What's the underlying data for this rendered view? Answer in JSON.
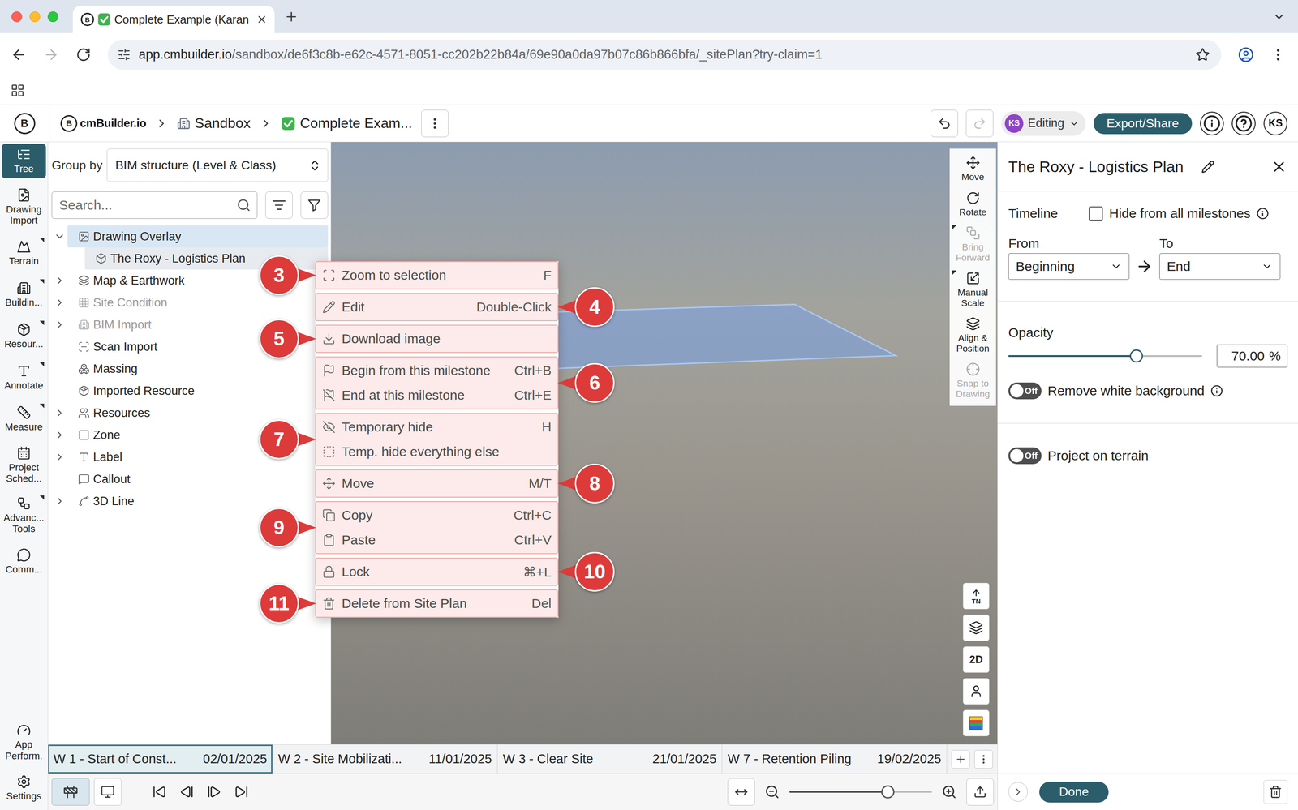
{
  "browser": {
    "tab": {
      "title": "Complete Example (Karan",
      "selected": true
    },
    "url_host": "app.cmbuilder.io",
    "url_path": "/sandbox/de6f3c8b-e62c-4571-8051-cc202b22b84a/69e90a0da97b07c86b866bfa/_sitePlan?try-claim=1",
    "forward_disabled": true
  },
  "header": {
    "logo_mark": "B",
    "brand": "cmBuilder.io",
    "breadcrumb": [
      "Sandbox",
      "Complete Exam..."
    ],
    "redo_disabled": true,
    "mode": {
      "avatar": "KS",
      "label": "Editing"
    },
    "export_label": "Export/Share",
    "user": "KS"
  },
  "rail": {
    "items": [
      {
        "label": "Tree",
        "selected": true,
        "has_submenu": false
      },
      {
        "label": "Drawing Import",
        "selected": false,
        "has_submenu": false
      },
      {
        "label": "Terrain",
        "selected": false,
        "has_submenu": true
      },
      {
        "label": "Buildin...",
        "selected": false,
        "has_submenu": true
      },
      {
        "label": "Resour...",
        "selected": false,
        "has_submenu": true
      },
      {
        "label": "Annotate",
        "selected": false,
        "has_submenu": true
      },
      {
        "label": "Measure",
        "selected": false,
        "has_submenu": true
      },
      {
        "label": "Project Sched...",
        "selected": false,
        "has_submenu": false
      },
      {
        "label": "Advanc... Tools",
        "selected": false,
        "has_submenu": true
      },
      {
        "label": "Comm...",
        "selected": false,
        "has_submenu": false
      }
    ],
    "bottom_items": [
      {
        "label": "App Perform.",
        "selected": false
      },
      {
        "label": "Settings",
        "selected": false
      }
    ]
  },
  "tree": {
    "group_by_label": "Group by",
    "group_by_value": "BIM structure (Level & Class)",
    "search_placeholder": "Search...",
    "items": [
      {
        "label": "Drawing Overlay",
        "level": 0,
        "expandable": true,
        "expanded": true,
        "selected": true,
        "context_target": false,
        "disabled": false
      },
      {
        "label": "The Roxy - Logistics Plan",
        "level": 1,
        "expandable": false,
        "expanded": false,
        "selected": false,
        "context_target": true,
        "disabled": false
      },
      {
        "label": "Map & Earthwork",
        "level": 0,
        "expandable": true,
        "expanded": false,
        "selected": false,
        "context_target": false,
        "disabled": false
      },
      {
        "label": "Site Condition",
        "level": 0,
        "expandable": true,
        "expanded": false,
        "selected": false,
        "context_target": false,
        "disabled": true
      },
      {
        "label": "BIM Import",
        "level": 0,
        "expandable": true,
        "expanded": false,
        "selected": false,
        "context_target": false,
        "disabled": true
      },
      {
        "label": "Scan Import",
        "level": 0,
        "expandable": false,
        "expanded": false,
        "selected": false,
        "context_target": false,
        "disabled": false
      },
      {
        "label": "Massing",
        "level": 0,
        "expandable": false,
        "expanded": false,
        "selected": false,
        "context_target": false,
        "disabled": false
      },
      {
        "label": "Imported Resource",
        "level": 0,
        "expandable": false,
        "expanded": false,
        "selected": false,
        "context_target": false,
        "disabled": false
      },
      {
        "label": "Resources",
        "level": 0,
        "expandable": true,
        "expanded": false,
        "selected": false,
        "context_target": false,
        "disabled": false
      },
      {
        "label": "Zone",
        "level": 0,
        "expandable": true,
        "expanded": false,
        "selected": false,
        "context_target": false,
        "disabled": false
      },
      {
        "label": "Label",
        "level": 0,
        "expandable": true,
        "expanded": false,
        "selected": false,
        "context_target": false,
        "disabled": false
      },
      {
        "label": "Callout",
        "level": 0,
        "expandable": false,
        "expanded": false,
        "selected": false,
        "context_target": false,
        "disabled": false
      },
      {
        "label": "3D Line",
        "level": 0,
        "expandable": true,
        "expanded": false,
        "selected": false,
        "context_target": false,
        "disabled": false
      }
    ]
  },
  "context_menu": {
    "groups": [
      {
        "callout": "3",
        "callout_side": "left",
        "items": [
          {
            "label": "Zoom to selection",
            "shortcut": "F"
          }
        ]
      },
      {
        "callout": "4",
        "callout_side": "right",
        "items": [
          {
            "label": "Edit",
            "shortcut": "Double-Click"
          }
        ]
      },
      {
        "callout": "5",
        "callout_side": "left",
        "items": [
          {
            "label": "Download image"
          }
        ]
      },
      {
        "callout": "6",
        "callout_side": "right",
        "items": [
          {
            "label": "Begin from this milestone",
            "shortcut": "Ctrl+B"
          },
          {
            "label": "End at this milestone",
            "shortcut": "Ctrl+E"
          }
        ]
      },
      {
        "callout": "7",
        "callout_side": "left",
        "items": [
          {
            "label": "Temporary hide",
            "shortcut": "H"
          },
          {
            "label": "Temp. hide everything else"
          }
        ]
      },
      {
        "callout": "8",
        "callout_side": "right",
        "items": [
          {
            "label": "Move",
            "shortcut": "M/T"
          }
        ]
      },
      {
        "callout": "9",
        "callout_side": "left",
        "items": [
          {
            "label": "Copy",
            "shortcut": "Ctrl+C"
          },
          {
            "label": "Paste",
            "shortcut": "Ctrl+V"
          }
        ]
      },
      {
        "callout": "10",
        "callout_side": "right",
        "items": [
          {
            "label": "Lock",
            "shortcut": "⌘+L"
          }
        ]
      },
      {
        "callout": "11",
        "callout_side": "left",
        "items": [
          {
            "label": "Delete from Site Plan",
            "shortcut": "Del"
          }
        ]
      }
    ]
  },
  "viewport": {
    "toolbar": [
      {
        "label": "Move",
        "disabled": false,
        "has_submenu": false
      },
      {
        "label": "Rotate",
        "disabled": false,
        "has_submenu": false
      },
      {
        "label": "Bring Forward",
        "disabled": true,
        "has_submenu": true
      },
      {
        "label": "Manual Scale",
        "disabled": false,
        "has_submenu": true
      },
      {
        "label": "Align & Position",
        "disabled": false,
        "has_submenu": false
      },
      {
        "label": "Snap to Drawing",
        "disabled": true,
        "has_submenu": false
      }
    ],
    "view_buttons": [
      {
        "kind": "north",
        "label": "TN"
      },
      {
        "kind": "layers"
      },
      {
        "kind": "text",
        "label": "2D"
      },
      {
        "kind": "person"
      },
      {
        "kind": "swatch"
      }
    ]
  },
  "milestones": [
    {
      "label": "W 1 - Start of Const...",
      "date": "02/01/2025",
      "selected": true
    },
    {
      "label": "W 2 - Site Mobilizati...",
      "date": "11/01/2025",
      "selected": false
    },
    {
      "label": "W 3 - Clear Site",
      "date": "21/01/2025",
      "selected": false
    },
    {
      "label": "W 7 - Retention Piling",
      "date": "19/02/2025",
      "selected": false
    }
  ],
  "playback": {
    "modes": [
      {
        "selected": true
      },
      {
        "selected": false
      }
    ],
    "zoom_level": 0.69
  },
  "properties": {
    "title": "The Roxy - Logistics Plan",
    "timeline_label": "Timeline",
    "hide_all": {
      "label": "Hide from all milestones",
      "checked": false
    },
    "from_label": "From",
    "from_value": "Beginning",
    "to_label": "To",
    "to_value": "End",
    "opacity_label": "Opacity",
    "opacity_level": 0.66,
    "opacity_value": "70.00",
    "opacity_unit": "%",
    "toggles": [
      {
        "label": "Remove white background",
        "state_label": "Off",
        "on": false,
        "info": true
      },
      {
        "label": "Project on terrain",
        "state_label": "Off",
        "on": false,
        "info": false
      }
    ],
    "done_label": "Done"
  }
}
